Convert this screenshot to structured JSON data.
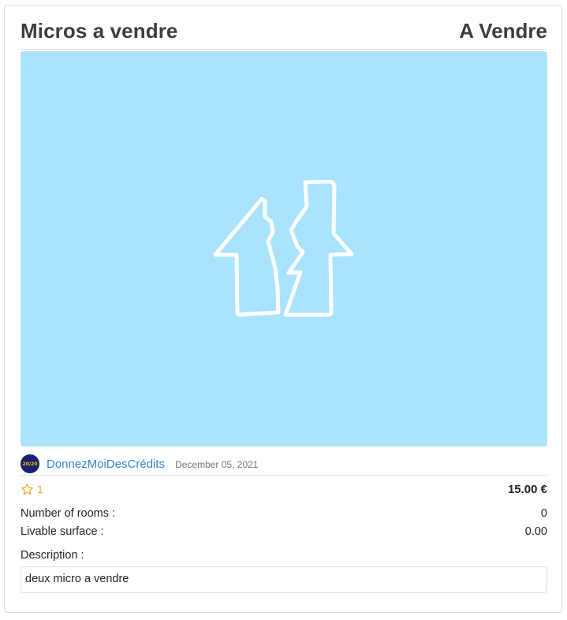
{
  "listing": {
    "title": "Micros a vendre",
    "status": "A Vendre",
    "image_icon": "broken-house-icon"
  },
  "author": {
    "avatar_text": "20/20",
    "name": "DonnezMoiDesCrédits",
    "date": "December 05, 2021"
  },
  "stats": {
    "favorites_count": "1",
    "price": "15.00 €"
  },
  "details": {
    "rooms_label": "Number of rooms :",
    "rooms_value": "0",
    "surface_label": "Livable surface :",
    "surface_value": "0.00"
  },
  "description": {
    "label": "Description :",
    "text": "deux micro a vendre"
  },
  "colors": {
    "image_background": "#a9e3fd",
    "link": "#2f86d6",
    "star": "#f0ad2b"
  }
}
